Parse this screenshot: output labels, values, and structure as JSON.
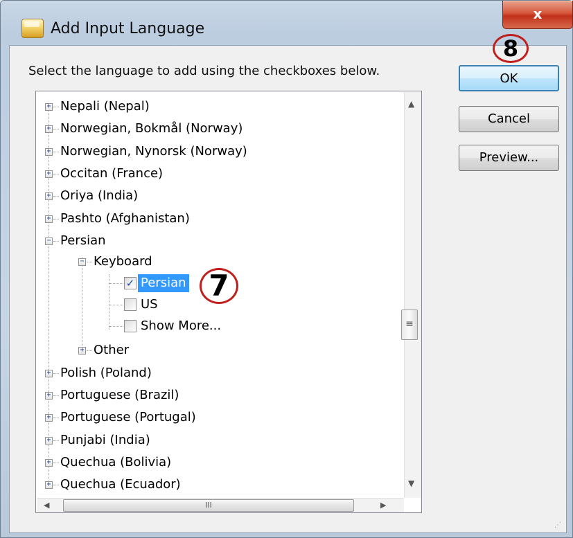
{
  "window": {
    "title": "Add Input Language",
    "close_label": "x"
  },
  "instruction": "Select the language to add using the checkboxes below.",
  "buttons": {
    "ok": "OK",
    "cancel": "Cancel",
    "preview": "Preview..."
  },
  "tree": {
    "top_items": [
      "Nepali (Nepal)",
      "Norwegian, Bokmål (Norway)",
      "Norwegian, Nynorsk (Norway)",
      "Occitan (France)",
      "Oriya (India)",
      "Pashto (Afghanistan)",
      "Persian"
    ],
    "persian_children": {
      "keyboard": "Keyboard",
      "keyboard_items": [
        {
          "label": "Persian",
          "checked": true
        },
        {
          "label": "US",
          "checked": false
        },
        {
          "label": "Show More...",
          "checked": false
        }
      ],
      "other": "Other"
    },
    "bottom_items": [
      "Polish (Poland)",
      "Portuguese (Brazil)",
      "Portuguese (Portugal)",
      "Punjabi (India)",
      "Quechua (Bolivia)",
      "Quechua (Ecuador)"
    ]
  },
  "step_markers": {
    "seven": "7",
    "eight": "8"
  },
  "icons": {
    "window_icon": "keyboard-language-icon",
    "expander_plus": "+",
    "expander_minus": "−",
    "check_mark": "✓",
    "scroll_thumb_grip": "≡",
    "hscroll_grip": "III"
  },
  "colors": {
    "selection": "#3399ff",
    "marker": "#c0201d",
    "default_button_border": "#3c7fb1"
  }
}
